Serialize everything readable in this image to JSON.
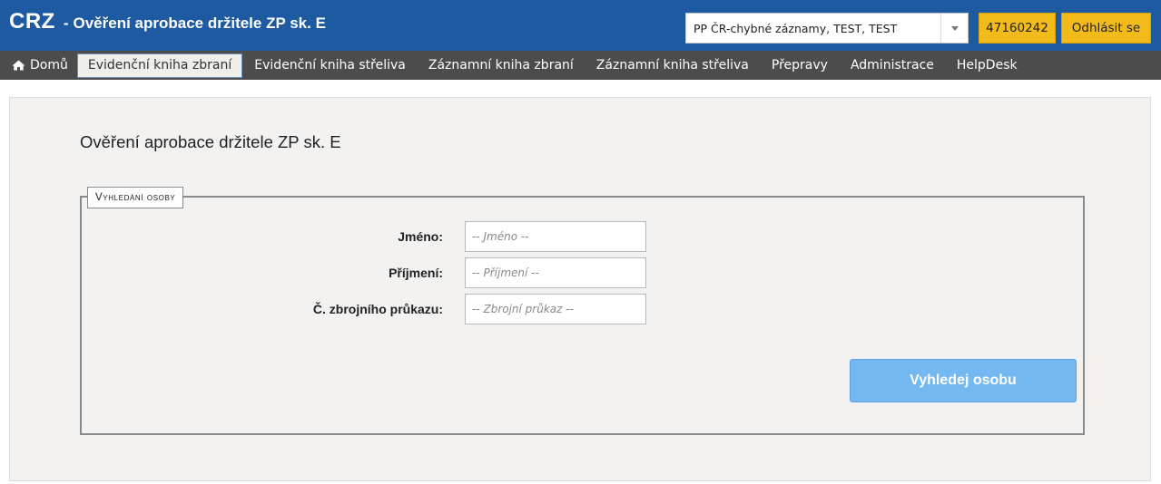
{
  "header": {
    "logo": "CRZ",
    "separator": "-",
    "title": "Ověření aprobace držitele ZP sk. E",
    "org_select": {
      "value": "PP ČR-chybné záznamy, TEST, TEST",
      "icon": "chevron-down-icon"
    },
    "user_id": "47160242",
    "logout_label": "Odhlásit se",
    "colors": {
      "header_bg": "#1e5aa1",
      "badge_bg": "#f2bb1a"
    }
  },
  "nav": {
    "home": {
      "label": "Domů",
      "icon": "home-icon"
    },
    "items": [
      {
        "label": "Evidenční kniha zbraní",
        "active": true
      },
      {
        "label": "Evidenční kniha střeliva",
        "active": false
      },
      {
        "label": "Záznamní kniha zbraní",
        "active": false
      },
      {
        "label": "Záznamní kniha střeliva",
        "active": false
      },
      {
        "label": "Přepravy",
        "active": false
      },
      {
        "label": "Administrace",
        "active": false
      },
      {
        "label": "HelpDesk",
        "active": false
      }
    ]
  },
  "main": {
    "heading": "Ověření aprobace držitele ZP sk. E",
    "search_section": {
      "legend": "Vyhledání osoby",
      "fields": [
        {
          "label": "Jméno:",
          "placeholder": "-- Jméno --",
          "value": ""
        },
        {
          "label": "Příjmení:",
          "placeholder": "-- Příjmení --",
          "value": ""
        },
        {
          "label": "Č. zbrojního průkazu:",
          "placeholder": "-- Zbrojní průkaz --",
          "value": ""
        }
      ],
      "submit_label": "Vyhledej osobu"
    }
  }
}
